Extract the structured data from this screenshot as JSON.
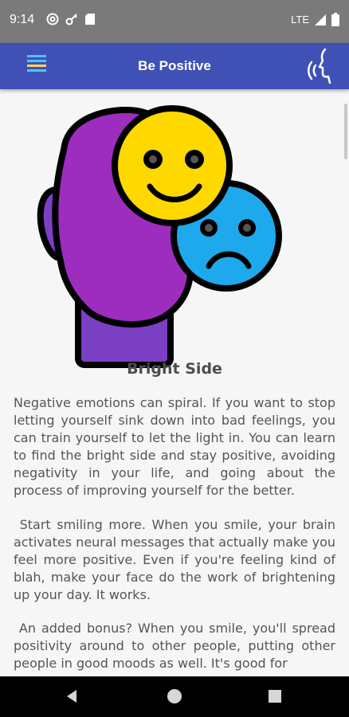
{
  "status_bar": {
    "time": "9:14",
    "network": "LTE",
    "left_icons": [
      "at-sign-icon",
      "key-icon",
      "sd-card-icon"
    ],
    "right_icons": [
      "signal-icon",
      "battery-icon"
    ]
  },
  "app_bar": {
    "title": "Be Positive",
    "color": "#3f51b5",
    "menu_icon": "menu-lines-icon",
    "action_icon": "voice-speak-icon"
  },
  "topic": {
    "title": "Bright Side",
    "illustration": "head-with-happy-and-sad-faces",
    "paragraphs": [
      "Negative emotions can spiral. If you want to stop letting yourself sink down into bad feelings, you can train yourself to let the light in. You can learn to find the bright side and stay positive, avoiding negativity in your life, and going about the process of improving yourself for the better.",
      " Start smiling more. When you smile, your brain activates neural messages that actually make you feel more positive. Even if you're feeling kind of blah, make your face do the work of brightening up your day. It works.",
      " An added bonus? When you smile, you'll spread positivity around to other people, putting other people in good moods as well. It's good for"
    ]
  },
  "colors": {
    "head_purple": "#9c2dbf",
    "neck_purple": "#7b3fc4",
    "happy_yellow": "#ffd800",
    "sad_blue": "#1ea9ec",
    "outline": "#000000"
  },
  "nav_bar": {
    "icons": [
      "back-triangle-icon",
      "home-circle-icon",
      "recent-square-icon"
    ]
  }
}
